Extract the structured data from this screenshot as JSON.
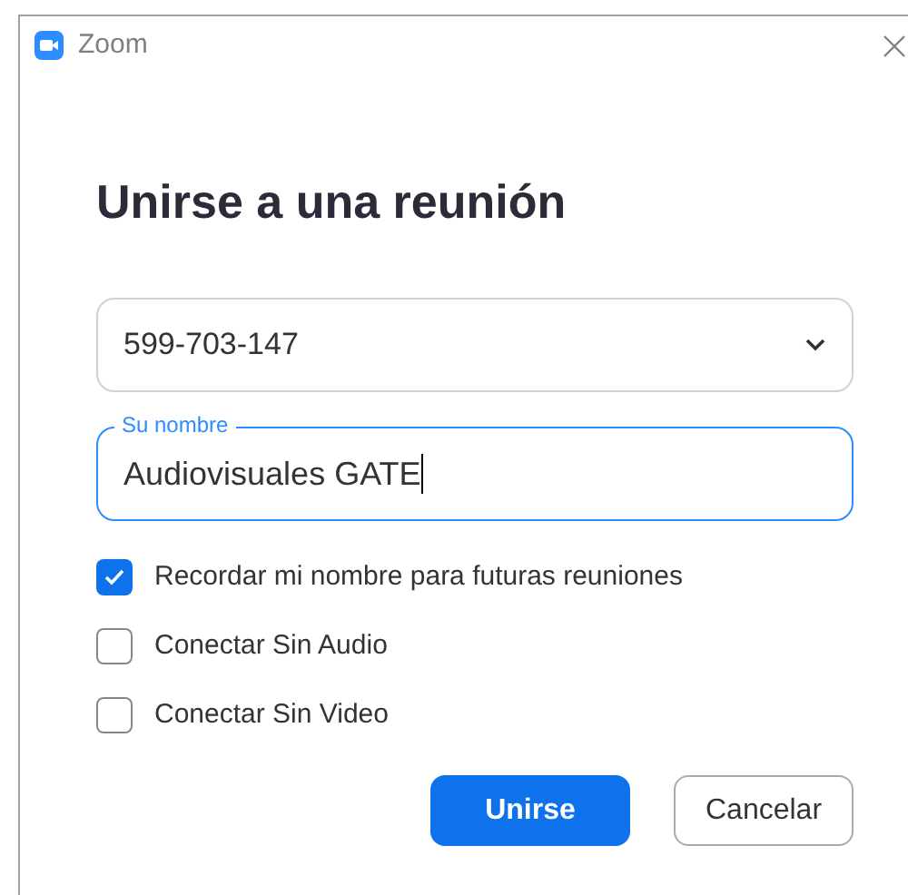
{
  "window": {
    "title": "Zoom"
  },
  "heading": "Unirse a una reunión",
  "meeting_id": {
    "value": "599-703-147"
  },
  "name_field": {
    "label": "Su nombre",
    "value": "Audiovisuales GATE",
    "focused": true
  },
  "options": [
    {
      "label": "Recordar mi nombre para futuras reuniones",
      "checked": true
    },
    {
      "label": "Conectar Sin Audio",
      "checked": false
    },
    {
      "label": "Conectar Sin Video",
      "checked": false
    }
  ],
  "buttons": [
    {
      "label": "Unirse",
      "kind": "primary"
    },
    {
      "label": "Cancelar",
      "kind": "secondary"
    }
  ]
}
